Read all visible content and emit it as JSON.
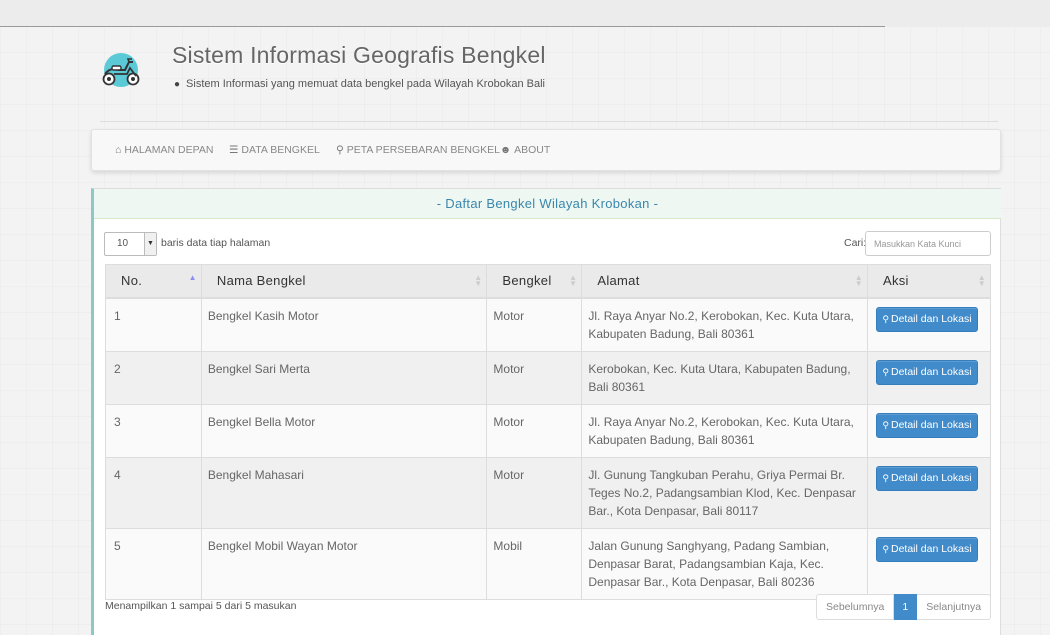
{
  "header": {
    "title": "Sistem Informasi Geografis Bengkel",
    "subtitle": "Sistem Informasi yang memuat data bengkel pada Wilayah Krobokan Bali",
    "logo_icon": "scooter-logo-icon"
  },
  "nav": [
    {
      "label": "HALAMAN DEPAN",
      "icon": "home-icon"
    },
    {
      "label": "DATA BENGKEL",
      "icon": "list-icon"
    },
    {
      "label": "PETA PERSEBARAN BENGKEL",
      "icon": "map-marker-icon"
    },
    {
      "label": "ABOUT",
      "icon": "user-icon"
    }
  ],
  "panel": {
    "title": "- Daftar Bengkel Wilayah Krobokan -"
  },
  "controls": {
    "page_length": "10",
    "page_length_label": "baris data tiap halaman",
    "search_label": "Cari:",
    "search_placeholder": "Masukkan Kata Kunci",
    "search_value": ""
  },
  "table": {
    "columns": [
      "No.",
      "Nama Bengkel",
      "Bengkel",
      "Alamat",
      "Aksi"
    ],
    "sorted_column": "No.",
    "rows": [
      {
        "no": "1",
        "nama": "Bengkel Kasih Motor",
        "jenis": "Motor",
        "alamat": "Jl. Raya Anyar No.2, Kerobokan, Kec. Kuta Utara, Kabupaten Badung, Bali 80361",
        "aksi": "Detail dan Lokasi"
      },
      {
        "no": "2",
        "nama": "Bengkel Sari Merta",
        "jenis": "Motor",
        "alamat": "Kerobokan, Kec. Kuta Utara, Kabupaten Badung, Bali 80361",
        "aksi": "Detail dan Lokasi"
      },
      {
        "no": "3",
        "nama": "Bengkel Bella Motor",
        "jenis": "Motor",
        "alamat": "Jl. Raya Anyar No.2, Kerobokan, Kec. Kuta Utara, Kabupaten Badung, Bali 80361",
        "aksi": "Detail dan Lokasi"
      },
      {
        "no": "4",
        "nama": "Bengkel Mahasari",
        "jenis": "Motor",
        "alamat": "Jl. Gunung Tangkuban Perahu, Griya Permai Br. Teges No.2, Padangsambian Klod, Kec. Denpasar Bar., Kota Denpasar, Bali 80117",
        "aksi": "Detail dan Lokasi"
      },
      {
        "no": "5",
        "nama": "Bengkel Mobil Wayan Motor",
        "jenis": "Mobil",
        "alamat": "Jalan Gunung Sanghyang, Padang Sambian, Denpasar Barat, Padangsambian Kaja, Kec. Denpasar Bar., Kota Denpasar, Bali 80236",
        "aksi": "Detail dan Lokasi"
      }
    ]
  },
  "footer": {
    "info": "Menampilkan 1 sampai 5 dari 5 masukan",
    "prev": "Sebelumnya",
    "current_page": "1",
    "next": "Selanjutnya"
  },
  "colors": {
    "accent": "#428bca",
    "panel_title": "#3a87ad",
    "panel_border": "#8ac9c5"
  }
}
